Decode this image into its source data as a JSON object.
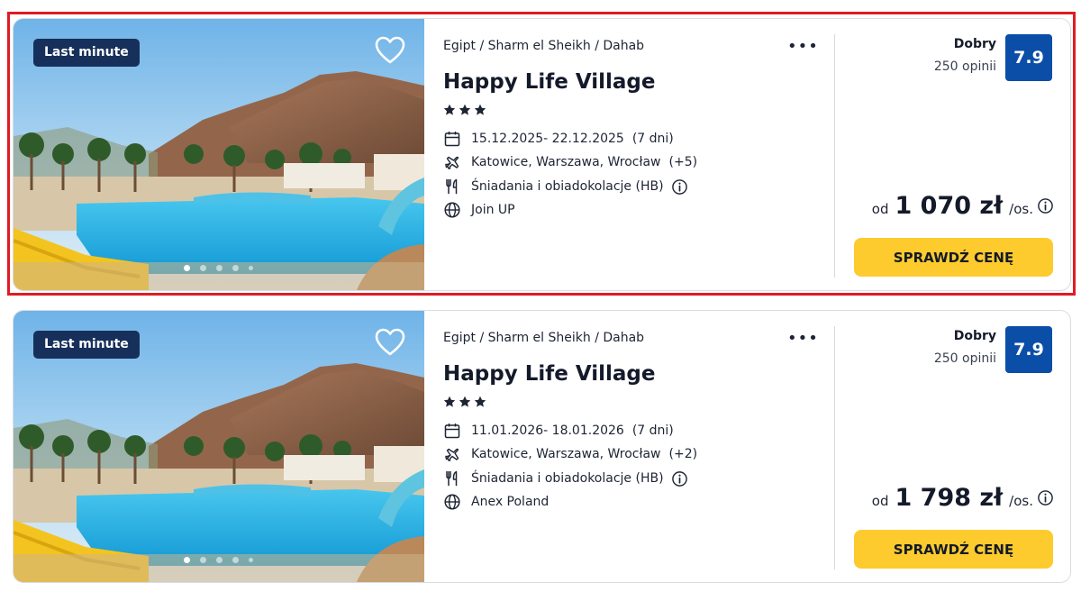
{
  "top_fragment": "",
  "colors": {
    "badge_bg": "#17305b",
    "score_bg": "#0b4ea8",
    "cta_bg": "#fdcb2d",
    "highlight": "#e01b24"
  },
  "icons": {
    "favorite": "heart-icon",
    "more": "more-dots-icon",
    "date": "calendar-icon",
    "departure": "plane-icon",
    "board": "cutlery-icon",
    "operator": "globe-icon",
    "info": "info-icon",
    "star": "star-icon"
  },
  "offers": [
    {
      "badge": "Last minute",
      "breadcrumb": "Egipt / Sharm el Sheikh / Dahab",
      "more": "•••",
      "name": "Happy Life Village",
      "stars": 3,
      "dates": "15.12.2025- 22.12.2025",
      "duration": "(7 dni)",
      "departures": "Katowice, Warszawa, Wrocław",
      "departures_more": "(+5)",
      "board": "Śniadania i obiadokolacje (HB)",
      "operator": "Join UP",
      "rating_label": "Dobry",
      "reviews": "250 opinii",
      "score": "7.9",
      "price_prefix": "od",
      "price": "1 070 zł",
      "price_suffix": "/os.",
      "cta": "SPRAWDŹ CENĘ",
      "gallery_slides": 5,
      "gallery_active": 1
    },
    {
      "badge": "Last minute",
      "breadcrumb": "Egipt / Sharm el Sheikh / Dahab",
      "more": "•••",
      "name": "Happy Life Village",
      "stars": 3,
      "dates": "11.01.2026- 18.01.2026",
      "duration": "(7 dni)",
      "departures": "Katowice, Warszawa, Wrocław",
      "departures_more": "(+2)",
      "board": "Śniadania i obiadokolacje (HB)",
      "operator": "Anex Poland",
      "rating_label": "Dobry",
      "reviews": "250 opinii",
      "score": "7.9",
      "price_prefix": "od",
      "price": "1 798 zł",
      "price_suffix": "/os.",
      "cta": "SPRAWDŹ CENĘ",
      "gallery_slides": 5,
      "gallery_active": 1
    }
  ]
}
